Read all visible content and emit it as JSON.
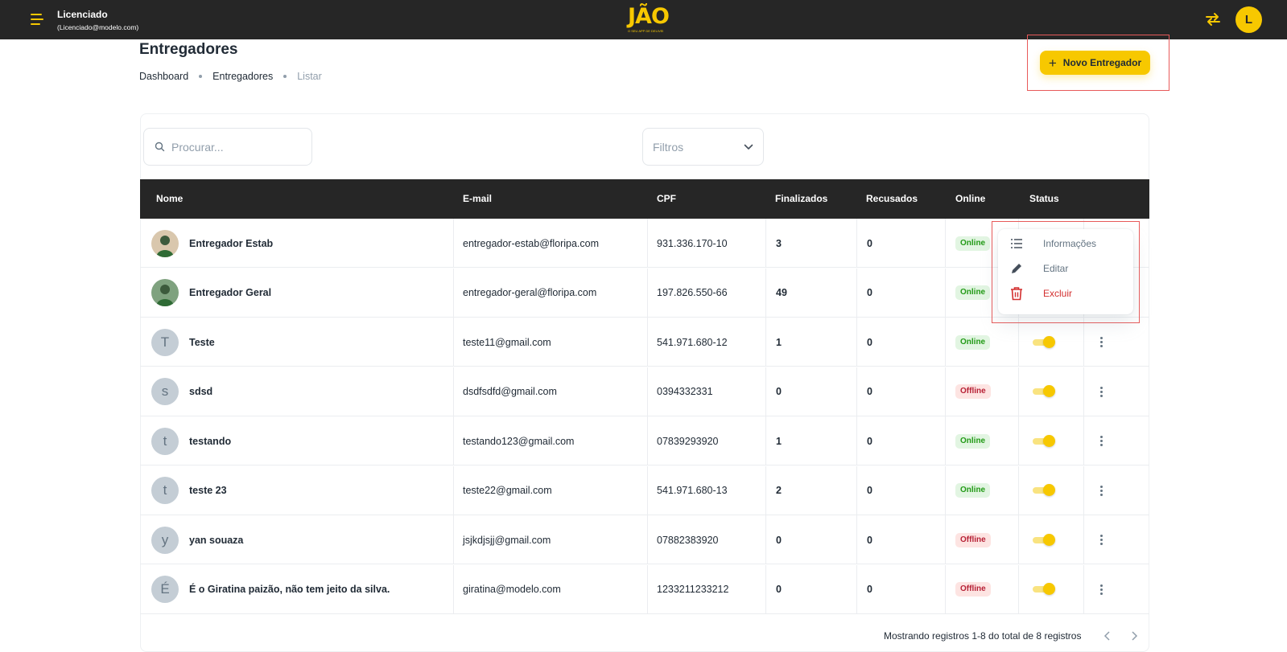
{
  "header": {
    "user_name": "Licenciado",
    "user_email": "(Licenciado@modelo.com)",
    "logo_text": "JÃO",
    "logo_subtitle": "O SEU APP DE DELIVERY",
    "avatar_letter": "L",
    "accent_color": "#f7c800",
    "bar_color": "#262626"
  },
  "page": {
    "title": "Entregadores",
    "breadcrumb": [
      "Dashboard",
      "Entregadores",
      "Listar"
    ],
    "new_button_label": "Novo Entregador"
  },
  "toolbar": {
    "search_placeholder": "Procurar...",
    "filter_label": "Filtros"
  },
  "table": {
    "columns": [
      "Nome",
      "E-mail",
      "CPF",
      "Finalizados",
      "Recusados",
      "Online",
      "Status"
    ],
    "rows": [
      {
        "avatar": "",
        "name": "Entregador Estab",
        "email": "entregador-estab@floripa.com",
        "cpf": "931.336.170-10",
        "finalizados": "3",
        "recusados": "0",
        "online": "Online"
      },
      {
        "avatar": "",
        "name": "Entregador Geral",
        "email": "entregador-geral@floripa.com",
        "cpf": "197.826.550-66",
        "finalizados": "49",
        "recusados": "0",
        "online": "Online"
      },
      {
        "avatar": "T",
        "name": "Teste",
        "email": "teste11@gmail.com",
        "cpf": "541.971.680-12",
        "finalizados": "1",
        "recusados": "0",
        "online": "Online"
      },
      {
        "avatar": "s",
        "name": "sdsd",
        "email": "dsdfsdfd@gmail.com",
        "cpf": "0394332331",
        "finalizados": "0",
        "recusados": "0",
        "online": "Offline"
      },
      {
        "avatar": "t",
        "name": "testando",
        "email": "testando123@gmail.com",
        "cpf": "07839293920",
        "finalizados": "1",
        "recusados": "0",
        "online": "Online"
      },
      {
        "avatar": "t",
        "name": "teste 23",
        "email": "teste22@gmail.com",
        "cpf": "541.971.680-13",
        "finalizados": "2",
        "recusados": "0",
        "online": "Online"
      },
      {
        "avatar": "y",
        "name": "yan souaza",
        "email": "jsjkdjsjj@gmail.com",
        "cpf": "07882383920",
        "finalizados": "0",
        "recusados": "0",
        "online": "Offline"
      },
      {
        "avatar": "É",
        "name": "É o Giratina paizão, não tem jeito da silva.",
        "email": "giratina@modelo.com",
        "cpf": "1233211233212",
        "finalizados": "0",
        "recusados": "0",
        "online": "Offline"
      }
    ]
  },
  "action_menu": {
    "items": [
      "Informações",
      "Editar",
      "Excluir"
    ]
  },
  "footer": {
    "summary": "Mostrando registros 1-8 do total de 8 registros"
  }
}
